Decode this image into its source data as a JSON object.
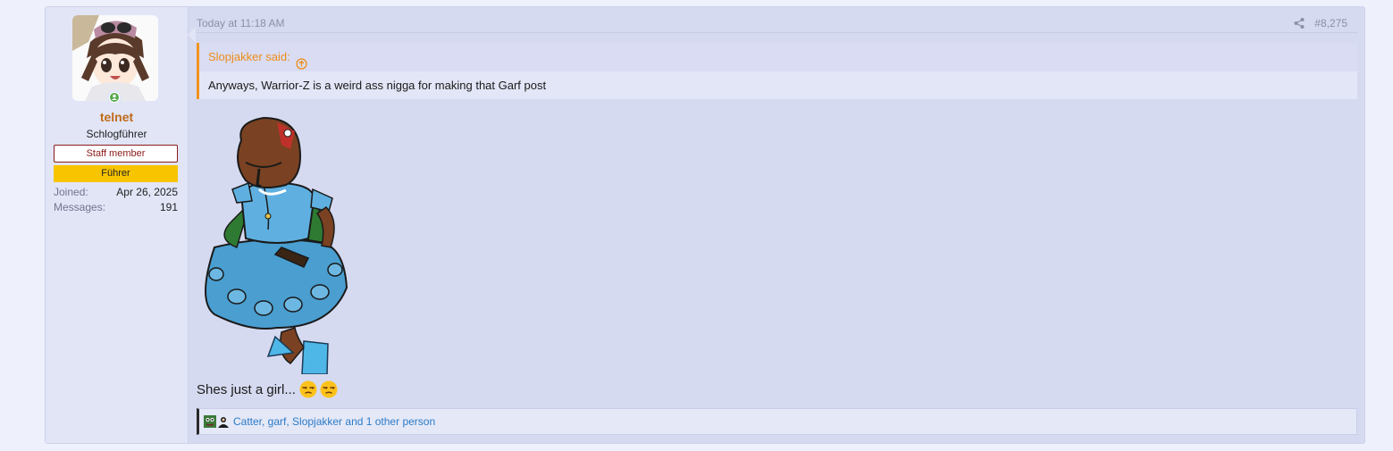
{
  "user": {
    "name": "telnet",
    "title": "Schlogführer",
    "banners": [
      "Staff member",
      "Führer"
    ],
    "joined_label": "Joined:",
    "joined_value": "Apr 26, 2025",
    "messages_label": "Messages:",
    "messages_value": "191",
    "status": "online"
  },
  "post": {
    "date": "Today at 11:18 AM",
    "number": "#8,275",
    "quote": {
      "author": "Slopjakker said:",
      "text": "Anyways, Warrior-Z is a weird ass nigga for making that Garf post"
    },
    "body_text": "Shes just a girl...",
    "emojis": [
      "unamused-face",
      "unamused-face"
    ],
    "reactions_text": "Catter, garf, Slopjakker and 1 other person"
  },
  "colors": {
    "accent": "#f2931e",
    "username": "#c06a18",
    "link": "#2b7bc8",
    "staff_banner": "#8b1a1a",
    "fuhrer_banner": "#f8c400"
  }
}
